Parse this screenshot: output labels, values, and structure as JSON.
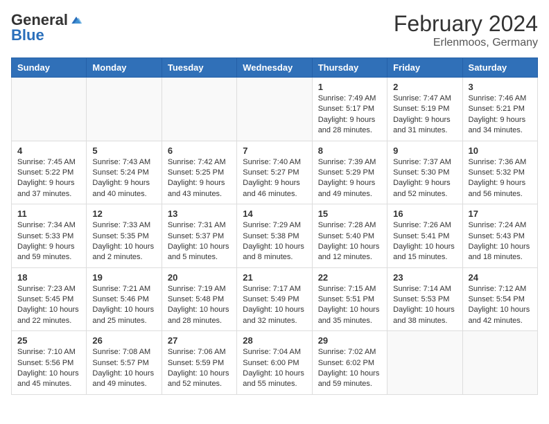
{
  "logo": {
    "general": "General",
    "blue": "Blue"
  },
  "title": "February 2024",
  "subtitle": "Erlenmoos, Germany",
  "days_of_week": [
    "Sunday",
    "Monday",
    "Tuesday",
    "Wednesday",
    "Thursday",
    "Friday",
    "Saturday"
  ],
  "weeks": [
    [
      {
        "day": "",
        "info": ""
      },
      {
        "day": "",
        "info": ""
      },
      {
        "day": "",
        "info": ""
      },
      {
        "day": "",
        "info": ""
      },
      {
        "day": "1",
        "info": "Sunrise: 7:49 AM\nSunset: 5:17 PM\nDaylight: 9 hours and 28 minutes."
      },
      {
        "day": "2",
        "info": "Sunrise: 7:47 AM\nSunset: 5:19 PM\nDaylight: 9 hours and 31 minutes."
      },
      {
        "day": "3",
        "info": "Sunrise: 7:46 AM\nSunset: 5:21 PM\nDaylight: 9 hours and 34 minutes."
      }
    ],
    [
      {
        "day": "4",
        "info": "Sunrise: 7:45 AM\nSunset: 5:22 PM\nDaylight: 9 hours and 37 minutes."
      },
      {
        "day": "5",
        "info": "Sunrise: 7:43 AM\nSunset: 5:24 PM\nDaylight: 9 hours and 40 minutes."
      },
      {
        "day": "6",
        "info": "Sunrise: 7:42 AM\nSunset: 5:25 PM\nDaylight: 9 hours and 43 minutes."
      },
      {
        "day": "7",
        "info": "Sunrise: 7:40 AM\nSunset: 5:27 PM\nDaylight: 9 hours and 46 minutes."
      },
      {
        "day": "8",
        "info": "Sunrise: 7:39 AM\nSunset: 5:29 PM\nDaylight: 9 hours and 49 minutes."
      },
      {
        "day": "9",
        "info": "Sunrise: 7:37 AM\nSunset: 5:30 PM\nDaylight: 9 hours and 52 minutes."
      },
      {
        "day": "10",
        "info": "Sunrise: 7:36 AM\nSunset: 5:32 PM\nDaylight: 9 hours and 56 minutes."
      }
    ],
    [
      {
        "day": "11",
        "info": "Sunrise: 7:34 AM\nSunset: 5:33 PM\nDaylight: 9 hours and 59 minutes."
      },
      {
        "day": "12",
        "info": "Sunrise: 7:33 AM\nSunset: 5:35 PM\nDaylight: 10 hours and 2 minutes."
      },
      {
        "day": "13",
        "info": "Sunrise: 7:31 AM\nSunset: 5:37 PM\nDaylight: 10 hours and 5 minutes."
      },
      {
        "day": "14",
        "info": "Sunrise: 7:29 AM\nSunset: 5:38 PM\nDaylight: 10 hours and 8 minutes."
      },
      {
        "day": "15",
        "info": "Sunrise: 7:28 AM\nSunset: 5:40 PM\nDaylight: 10 hours and 12 minutes."
      },
      {
        "day": "16",
        "info": "Sunrise: 7:26 AM\nSunset: 5:41 PM\nDaylight: 10 hours and 15 minutes."
      },
      {
        "day": "17",
        "info": "Sunrise: 7:24 AM\nSunset: 5:43 PM\nDaylight: 10 hours and 18 minutes."
      }
    ],
    [
      {
        "day": "18",
        "info": "Sunrise: 7:23 AM\nSunset: 5:45 PM\nDaylight: 10 hours and 22 minutes."
      },
      {
        "day": "19",
        "info": "Sunrise: 7:21 AM\nSunset: 5:46 PM\nDaylight: 10 hours and 25 minutes."
      },
      {
        "day": "20",
        "info": "Sunrise: 7:19 AM\nSunset: 5:48 PM\nDaylight: 10 hours and 28 minutes."
      },
      {
        "day": "21",
        "info": "Sunrise: 7:17 AM\nSunset: 5:49 PM\nDaylight: 10 hours and 32 minutes."
      },
      {
        "day": "22",
        "info": "Sunrise: 7:15 AM\nSunset: 5:51 PM\nDaylight: 10 hours and 35 minutes."
      },
      {
        "day": "23",
        "info": "Sunrise: 7:14 AM\nSunset: 5:53 PM\nDaylight: 10 hours and 38 minutes."
      },
      {
        "day": "24",
        "info": "Sunrise: 7:12 AM\nSunset: 5:54 PM\nDaylight: 10 hours and 42 minutes."
      }
    ],
    [
      {
        "day": "25",
        "info": "Sunrise: 7:10 AM\nSunset: 5:56 PM\nDaylight: 10 hours and 45 minutes."
      },
      {
        "day": "26",
        "info": "Sunrise: 7:08 AM\nSunset: 5:57 PM\nDaylight: 10 hours and 49 minutes."
      },
      {
        "day": "27",
        "info": "Sunrise: 7:06 AM\nSunset: 5:59 PM\nDaylight: 10 hours and 52 minutes."
      },
      {
        "day": "28",
        "info": "Sunrise: 7:04 AM\nSunset: 6:00 PM\nDaylight: 10 hours and 55 minutes."
      },
      {
        "day": "29",
        "info": "Sunrise: 7:02 AM\nSunset: 6:02 PM\nDaylight: 10 hours and 59 minutes."
      },
      {
        "day": "",
        "info": ""
      },
      {
        "day": "",
        "info": ""
      }
    ]
  ]
}
